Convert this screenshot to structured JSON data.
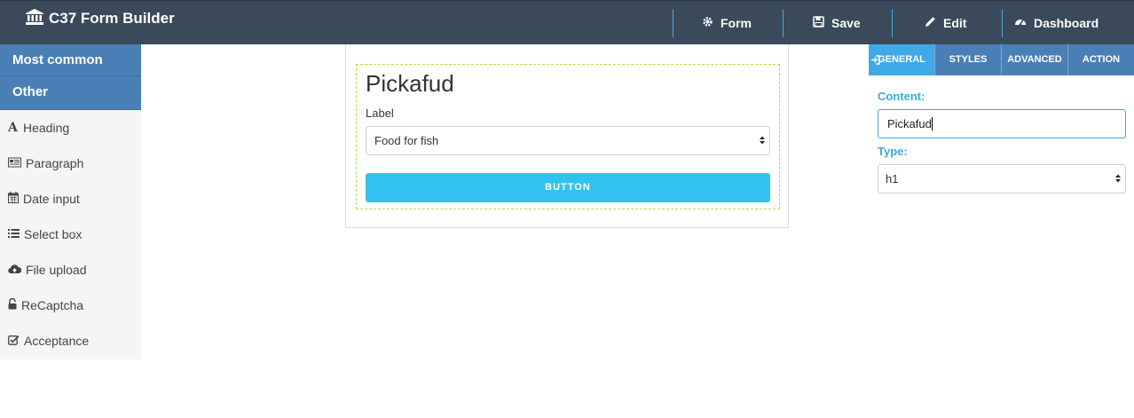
{
  "app": {
    "title": "C37 Form Builder"
  },
  "topnav": [
    {
      "label": "Form",
      "icon": "gear-icon"
    },
    {
      "label": "Save",
      "icon": "floppy-icon"
    },
    {
      "label": "Edit",
      "icon": "pencil-icon"
    },
    {
      "label": "Dashboard",
      "icon": "dashboard-icon"
    }
  ],
  "sidebar": {
    "groups": [
      "Most common",
      "Other"
    ],
    "items": [
      {
        "label": "Heading",
        "icon": "heading-icon"
      },
      {
        "label": "Paragraph",
        "icon": "paragraph-icon"
      },
      {
        "label": "Date input",
        "icon": "calendar-icon"
      },
      {
        "label": "Select box",
        "icon": "list-icon"
      },
      {
        "label": "File upload",
        "icon": "cloud-upload-icon"
      },
      {
        "label": "ReCaptcha",
        "icon": "lock-icon"
      },
      {
        "label": "Acceptance",
        "icon": "checkbox-icon"
      }
    ]
  },
  "form": {
    "title": "Pickafud",
    "field_label": "Label",
    "select_value": "Food for fish",
    "button_label": "BUTTON"
  },
  "panel": {
    "tabs": [
      "GENERAL",
      "STYLES",
      "ADVANCED",
      "ACTION"
    ],
    "active_tab": "GENERAL",
    "content_label": "Content:",
    "content_value": "Pickafud",
    "type_label": "Type:",
    "type_value": "h1"
  },
  "colors": {
    "topbar": "#3a4a5b",
    "sidebar_group": "#4a7fb5",
    "accent": "#3aa9e0",
    "button": "#33c2f0",
    "dashed_border": "#a7e04a"
  }
}
